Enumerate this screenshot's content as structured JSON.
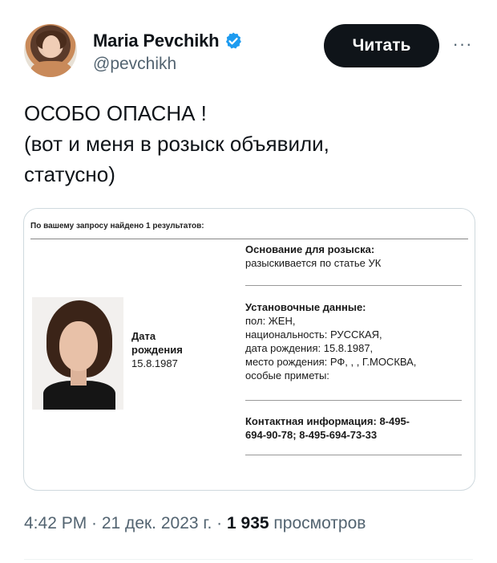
{
  "author": {
    "name": "Maria Pevchikh",
    "handle": "@pevchikh",
    "verified_color": "#1d9bf0"
  },
  "follow_label": "Читать",
  "more_label": "···",
  "tweet_lines": [
    "ОСОБО ОПАСНА !",
    "(вот и меня в розыск объявили,",
    "статусно)"
  ],
  "document": {
    "header": "По вашему запросу найдено 1 результатов:",
    "dob_label_1": "Дата",
    "dob_label_2": "рождения",
    "dob_value": "15.8.1987",
    "basis_title": "Основание для розыска:",
    "basis_text": "разыскивается по статье УК",
    "id_title": "Установочные данные:",
    "id_lines": [
      "пол: ЖЕН,",
      "национальность: РУССКАЯ,",
      "дата рождения: 15.8.1987,",
      "место рождения: РФ, , , Г.МОСКВА,",
      "особые приметы:"
    ],
    "contact_title": "Контактная информация:",
    "contact_first": "8-495-",
    "contact_second": "694-90-78; 8-495-694-73-33"
  },
  "meta": {
    "time_date": "4:42 PM · 21 дек. 2023 г. · ",
    "views_count": "1 935",
    "views_label": " просмотров"
  }
}
